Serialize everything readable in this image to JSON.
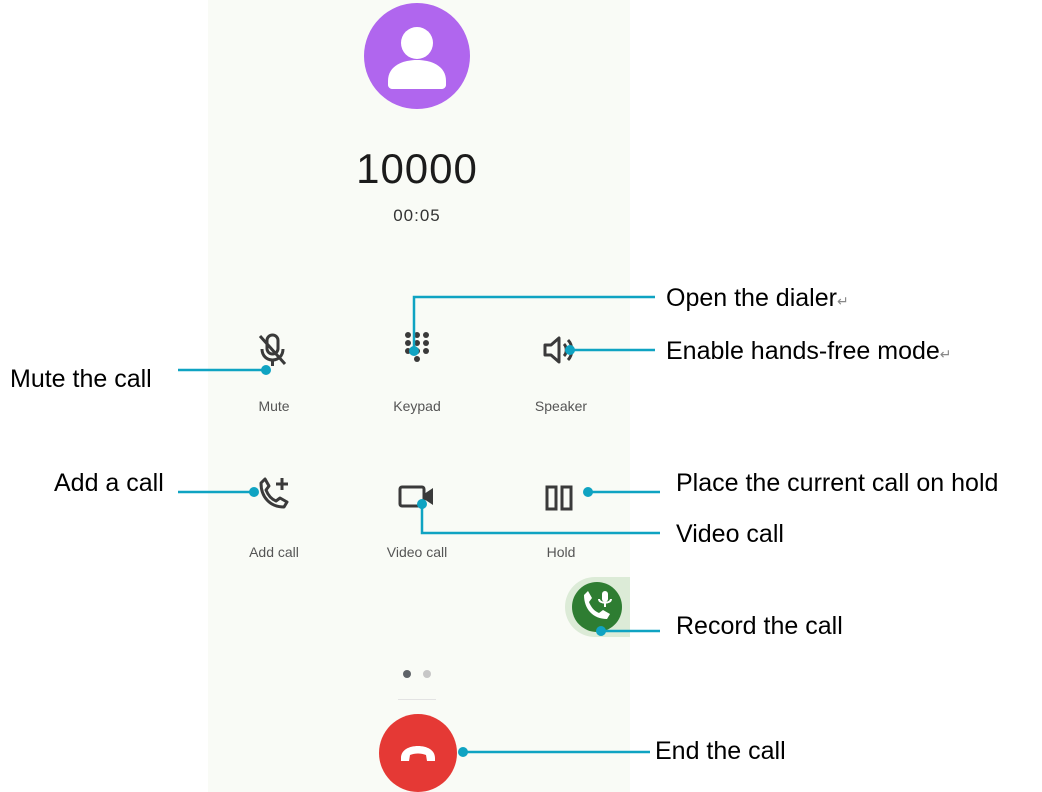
{
  "call": {
    "number": "10000",
    "timer": "00:05"
  },
  "controls": {
    "mute": {
      "label": "Mute",
      "icon": "mic-off-icon"
    },
    "keypad": {
      "label": "Keypad",
      "icon": "dialpad-icon"
    },
    "speaker": {
      "label": "Speaker",
      "icon": "speaker-icon"
    },
    "add_call": {
      "label": "Add call",
      "icon": "add-call-icon"
    },
    "video_call": {
      "label": "Video call",
      "icon": "videocam-icon"
    },
    "hold": {
      "label": "Hold",
      "icon": "pause-icon"
    },
    "record": {
      "icon": "record-call-icon"
    },
    "end_call": {
      "icon": "call-end-icon"
    }
  },
  "pager": {
    "pages": 2,
    "current": 1
  },
  "annotations": {
    "open_dialer": "Open the dialer",
    "hands_free": "Enable hands-free mode",
    "mute_call": "Mute the call",
    "add_a_call": "Add a call",
    "place_on_hold": "Place the current call on hold",
    "video_call": "Video call",
    "record_call": "Record the call",
    "end_call": "End the call",
    "line_break_mark": "↵"
  },
  "colors": {
    "avatar": "#b066ee",
    "end_call": "#e53935",
    "record": "#2e7d32",
    "record_bg": "#dcebd7",
    "callout_line": "#0fa3c2",
    "phone_bg": "#f9fbf6"
  }
}
